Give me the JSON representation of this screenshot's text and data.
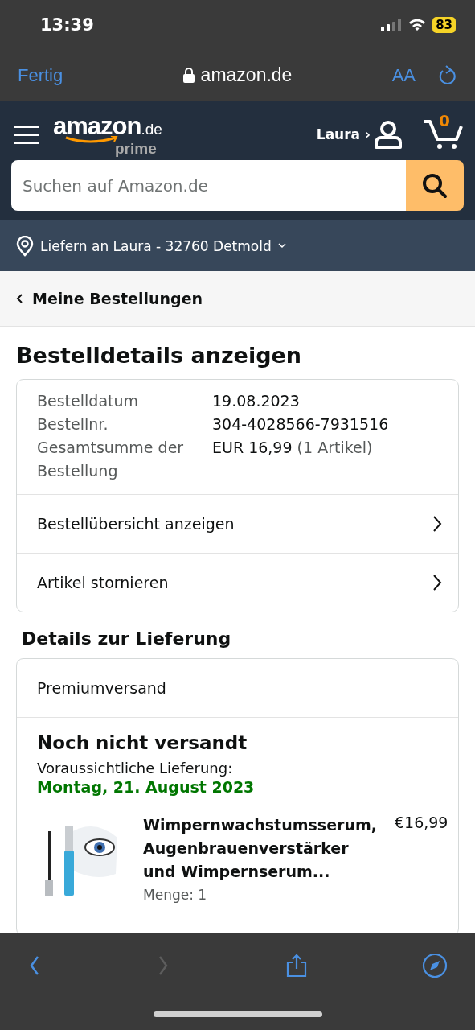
{
  "status_bar": {
    "time": "13:39",
    "battery": "83"
  },
  "browser": {
    "done": "Fertig",
    "address": "amazon.de",
    "text_size": "AA"
  },
  "header": {
    "logo": "amazon",
    "logo_suffix": ".de",
    "logo_sub": "prime",
    "account": "Laura ›",
    "cart_count": "0",
    "search_placeholder": "Suchen auf Amazon.de"
  },
  "location": "Liefern an Laura - 32760 Detmold",
  "breadcrumb": "Meine Bestellungen",
  "title": "Bestelldetails anzeigen",
  "order_info": [
    {
      "label": "Bestelldatum",
      "value": "19.08.2023"
    },
    {
      "label": "Bestellnr.",
      "value": "304-4028566-7931516"
    },
    {
      "label": "Gesamtsumme der Bestellung",
      "value": "EUR 16,99",
      "note": "(1 Artikel)"
    }
  ],
  "order_links": [
    "Bestellübersicht anzeigen",
    "Artikel stornieren"
  ],
  "delivery_heading": "Details zur Lieferung",
  "delivery": {
    "method": "Premiumversand",
    "status": "Noch nicht versandt",
    "eta_label": "Voraussichtliche Lieferung:",
    "eta_date": "Montag, 21. August 2023",
    "item": {
      "title": "Wimpernwachstumsserum, Augenbrauenverstärker und Wimpernserum...",
      "price": "€16,99",
      "quantity": "Menge: 1"
    }
  },
  "toolbar": [
    {
      "kind": "back",
      "disabled": false
    },
    {
      "kind": "forward",
      "disabled": true
    },
    {
      "kind": "share",
      "disabled": false
    },
    {
      "kind": "compass",
      "disabled": false
    }
  ]
}
